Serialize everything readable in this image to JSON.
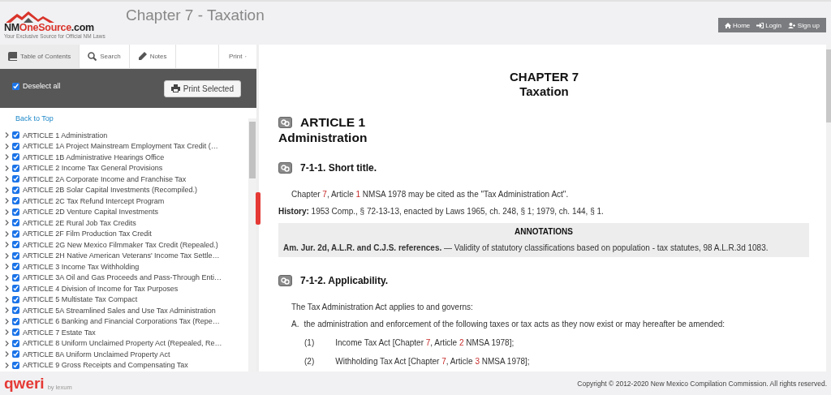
{
  "header": {
    "logo": {
      "brand_dark": "NM",
      "brand_red": "OneSource",
      "brand_suffix": ".com",
      "tagline": "Your Exclusive Source for Official NM Laws"
    },
    "title": "Chapter 7 - Taxation",
    "nav": [
      "Home",
      "Login",
      "Sign up"
    ]
  },
  "sidebar": {
    "tabs": [
      {
        "label": "Table of Contents",
        "selected": true
      },
      {
        "label": "Search",
        "selected": false
      },
      {
        "label": "Notes",
        "selected": false
      }
    ],
    "print_menu": "Print",
    "select_all": {
      "label": "Deselect all",
      "checked": true
    },
    "print_button": "Print Selected",
    "back_to_top": "Back to Top",
    "items": [
      {
        "label": "ARTICLE 1 Administration",
        "checked": true
      },
      {
        "label": "ARTICLE 1A Project Mainstream Employment Tax Credit (…",
        "checked": true
      },
      {
        "label": "ARTICLE 1B Administrative Hearings Office",
        "checked": true
      },
      {
        "label": "ARTICLE 2 Income Tax General Provisions",
        "checked": true
      },
      {
        "label": "ARTICLE 2A Corporate Income and Franchise Tax",
        "checked": true
      },
      {
        "label": "ARTICLE 2B Solar Capital Investments (Recompiled.)",
        "checked": true
      },
      {
        "label": "ARTICLE 2C Tax Refund Intercept Program",
        "checked": true
      },
      {
        "label": "ARTICLE 2D Venture Capital Investments",
        "checked": true
      },
      {
        "label": "ARTICLE 2E Rural Job Tax Credits",
        "checked": true
      },
      {
        "label": "ARTICLE 2F Film Production Tax Credit",
        "checked": true
      },
      {
        "label": "ARTICLE 2G New Mexico Filmmaker Tax Credit (Repealed.)",
        "checked": true
      },
      {
        "label": "ARTICLE 2H Native American Veterans' Income Tax Settle…",
        "checked": true
      },
      {
        "label": "ARTICLE 3 Income Tax Withholding",
        "checked": true
      },
      {
        "label": "ARTICLE 3A Oil and Gas Proceeds and Pass-Through Enti…",
        "checked": true
      },
      {
        "label": "ARTICLE 4 Division of Income for Tax Purposes",
        "checked": true
      },
      {
        "label": "ARTICLE 5 Multistate Tax Compact",
        "checked": true
      },
      {
        "label": "ARTICLE 5A Streamlined Sales and Use Tax Administration",
        "checked": true
      },
      {
        "label": "ARTICLE 6 Banking and Financial Corporations Tax (Repe…",
        "checked": true
      },
      {
        "label": "ARTICLE 7 Estate Tax",
        "checked": true
      },
      {
        "label": "ARTICLE 8 Uniform Unclaimed Property Act (Repealed, Re…",
        "checked": true
      },
      {
        "label": "ARTICLE 8A Uniform Unclaimed Property Act",
        "checked": true
      },
      {
        "label": "ARTICLE 9 Gross Receipts and Compensating Tax",
        "checked": true
      }
    ]
  },
  "document": {
    "chapter": "CHAPTER 7",
    "chapter_title": "Taxation",
    "blocks": [
      {
        "kind": "article",
        "heading": "ARTICLE 1",
        "subtitle": "Administration"
      },
      {
        "kind": "section",
        "heading": "7-1-1. Short title."
      },
      {
        "kind": "para",
        "segments": [
          {
            "text": "Chapter ",
            "link": false
          },
          {
            "text": "7",
            "link": true
          },
          {
            "text": ", Article ",
            "link": false
          },
          {
            "text": "1",
            "link": true
          },
          {
            "text": " NMSA 1978 may be cited as the \"Tax Administration Act\".",
            "link": false
          }
        ]
      },
      {
        "kind": "history",
        "label": "History:",
        "text": "1953 Comp., § 72-13-13, enacted by Laws 1965, ch. 248, § 1; 1979, ch. 144, § 1."
      },
      {
        "kind": "annotations",
        "title": "ANNOTATIONS",
        "text": "**Am. Jur. 2d, A.L.R. and C.J.S. references.** — Validity of statutory classifications based on population - tax statutes, 98 A.L.R.3d 1083."
      },
      {
        "kind": "section",
        "heading": "7-1-2. Applicability."
      },
      {
        "kind": "para",
        "segments": [
          {
            "text": "The Tax Administration Act applies to and governs:",
            "link": false
          }
        ]
      },
      {
        "kind": "item",
        "marker": "A.",
        "segments": [
          {
            "text": "the administration and enforcement of the following taxes or tax acts as they now exist or may hereafter be amended:",
            "link": false
          }
        ]
      },
      {
        "kind": "subitem",
        "marker": "(1)",
        "segments": [
          {
            "text": "Income Tax Act [Chapter ",
            "link": false
          },
          {
            "text": "7",
            "link": true
          },
          {
            "text": ", Article ",
            "link": false
          },
          {
            "text": "2",
            "link": true
          },
          {
            "text": " NMSA 1978];",
            "link": false
          }
        ]
      },
      {
        "kind": "subitem",
        "marker": "(2)",
        "segments": [
          {
            "text": "Withholding Tax Act [Chapter ",
            "link": false
          },
          {
            "text": "7",
            "link": true
          },
          {
            "text": ", Article ",
            "link": false
          },
          {
            "text": "3",
            "link": true
          },
          {
            "text": " NMSA 1978];",
            "link": false
          }
        ]
      }
    ]
  },
  "footer": {
    "brand": "qweri",
    "brand_by": "by lexum",
    "copyright": "Copyright © 2012-2020 New Mexico Compilation Commission. All rights reserved."
  }
}
